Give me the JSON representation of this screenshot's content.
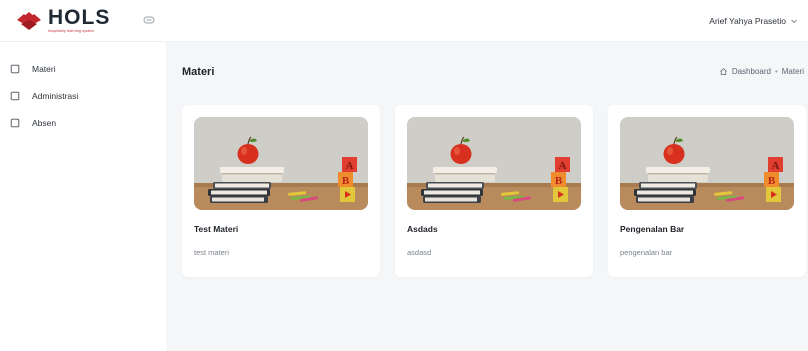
{
  "header": {
    "logo": {
      "title": "HOLS",
      "tagline": "hospitality learning system"
    },
    "user_name": "Arief Yahya Prasetio"
  },
  "sidebar": {
    "items": [
      {
        "label": "Materi"
      },
      {
        "label": "Administrasi"
      },
      {
        "label": "Absen"
      }
    ]
  },
  "main": {
    "title": "Materi",
    "breadcrumb": {
      "home": "Dashboard",
      "separator": "•",
      "current": "Materi"
    },
    "cards": [
      {
        "title": "Test Materi",
        "description": "test materi",
        "image": "apple-books-blocks-image"
      },
      {
        "title": "Asdads",
        "description": "asdasd",
        "image": "apple-books-blocks-image"
      },
      {
        "title": "Pengenalan Bar",
        "description": "pengenalan bar",
        "image": "apple-books-blocks-image"
      }
    ]
  },
  "colors": {
    "brand_red": "#c2262e",
    "page_background": "#f5f6f8",
    "surface": "#ffffff",
    "text_dark": "#1f2328",
    "text_muted": "#7b838c"
  }
}
